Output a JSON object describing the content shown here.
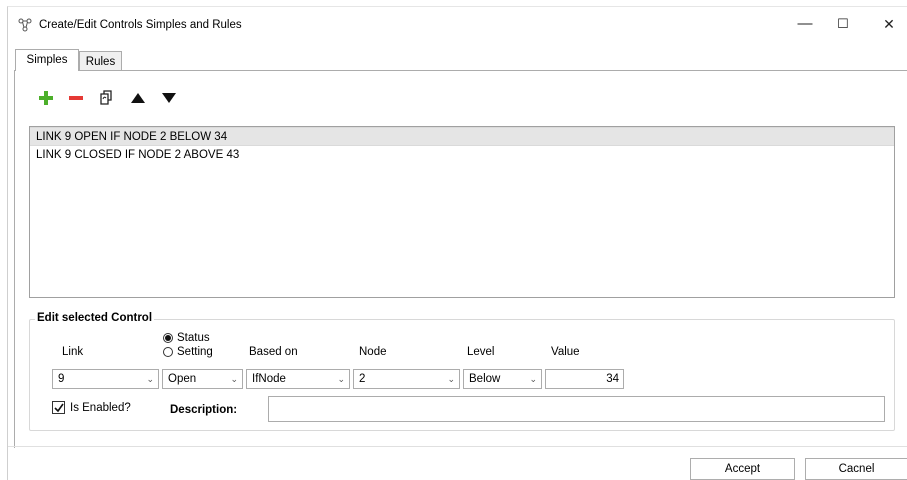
{
  "window": {
    "title": "Create/Edit Controls Simples and Rules",
    "minimize_glyph": "—",
    "maximize_glyph": "☐",
    "close_glyph": "✕"
  },
  "tabs": [
    {
      "label": "Simples",
      "active": true
    },
    {
      "label": "Rules",
      "active": false
    }
  ],
  "toolbar": {
    "icons": [
      "add-icon",
      "remove-icon",
      "copy-icon",
      "move-up-icon",
      "move-down-icon"
    ],
    "colors": {
      "add": "#4caf2a",
      "remove": "#e53935"
    }
  },
  "controls_list": {
    "items": [
      {
        "text": "LINK 9 OPEN IF NODE 2 BELOW 34",
        "selected": true
      },
      {
        "text": "LINK 9 CLOSED IF NODE 2 ABOVE 43",
        "selected": false
      }
    ]
  },
  "edit": {
    "group_title": "Edit selected Control",
    "link_label": "Link",
    "radio_status": "Status",
    "radio_setting": "Setting",
    "based_on_label": "Based on",
    "node_label": "Node",
    "level_label": "Level",
    "value_label": "Value",
    "link_value": "9",
    "status_value": "Open",
    "based_on_value": "IfNode",
    "node_value": "2",
    "level_value": "Below",
    "value": "34",
    "is_enabled_label": "Is Enabled?",
    "is_enabled": true,
    "description_label": "Description:",
    "description_value": ""
  },
  "buttons": {
    "accept": "Accept",
    "cancel": "Cacnel"
  }
}
